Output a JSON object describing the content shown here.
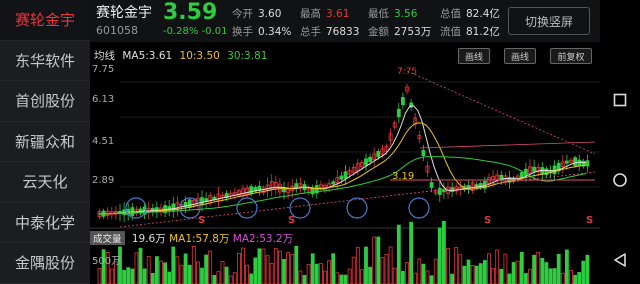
{
  "sidebar": {
    "items": [
      {
        "label": "赛轮金宇",
        "active": true
      },
      {
        "label": "东华软件",
        "active": false
      },
      {
        "label": "首创股份",
        "active": false
      },
      {
        "label": "新疆众和",
        "active": false
      },
      {
        "label": "云天化",
        "active": false
      },
      {
        "label": "中泰化学",
        "active": false
      },
      {
        "label": "金隅股份",
        "active": false
      }
    ]
  },
  "header": {
    "name": "赛轮金宇",
    "code": "601058",
    "price": "3.59",
    "change": "-0.28% -0.01",
    "quotes": {
      "open_k": "今开",
      "open_v": "3.60",
      "high_k": "最高",
      "high_v": "3.61",
      "low_k": "最低",
      "low_v": "3.56",
      "cap_k": "总值",
      "cap_v": "82.4亿",
      "turn_k": "换手",
      "turn_v": "0.34%",
      "hand_k": "总手",
      "hand_v": "76833",
      "amt_k": "金额",
      "amt_v": "2753万",
      "float_k": "流值",
      "float_v": "81.2亿"
    },
    "switch_label": "切换竖屏"
  },
  "chart": {
    "ma_label": "均线",
    "ma5": "MA5:3.61",
    "ma10": "10:3.50",
    "ma30": "30:3.81",
    "buttons": {
      "draw": "画线",
      "edit": "画线",
      "adjust": "前复权"
    },
    "yaxis": [
      "7.75",
      "6.13",
      "4.51",
      "2.89"
    ],
    "annotation_high": "7.75",
    "annotation_low": "3.19",
    "signal_s": "S",
    "volume": {
      "tag": "成交量",
      "value": "19.6万",
      "ma1": "MA1:57.8万",
      "ma2": "MA2:53.2万",
      "axis": "500万"
    },
    "colors": {
      "up": "#e8353b",
      "down": "#2ecc40",
      "ma5": "#e0e0e0",
      "ma10": "#f1c40f",
      "ma30": "#2ecc40"
    }
  },
  "nav": {
    "back": "back-icon",
    "home": "home-icon",
    "recent": "recent-apps-icon"
  }
}
